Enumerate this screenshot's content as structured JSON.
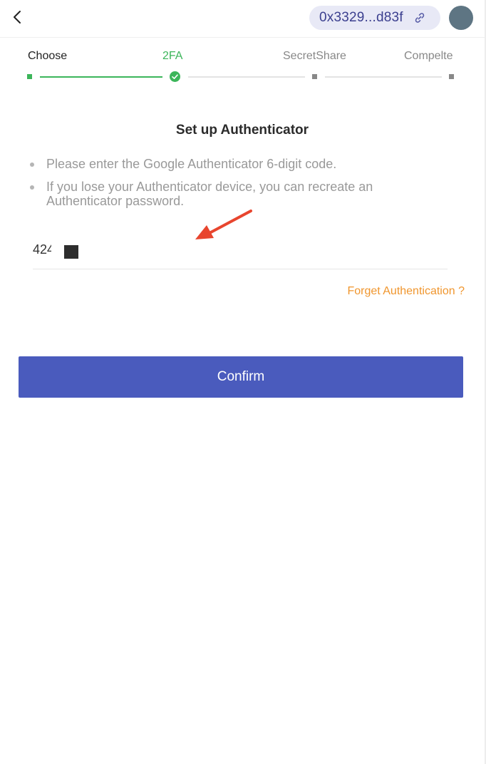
{
  "header": {
    "back_icon": "chevron-left-icon",
    "wallet_address": "0x3329...d83f",
    "link_icon": "link-icon",
    "avatar_color": "#5e7583"
  },
  "stepper": {
    "steps": [
      {
        "label": "Choose",
        "state": "done"
      },
      {
        "label": "2FA",
        "state": "current"
      },
      {
        "label": "SecretShare",
        "state": "pending"
      },
      {
        "label": "Compelte",
        "state": "pending"
      }
    ],
    "colors": {
      "active": "#3cb55a",
      "inactive": "#888888",
      "track_inactive": "#e3e3e3"
    }
  },
  "main": {
    "title": "Set up Authenticator",
    "instructions": [
      "Please enter the Google Authenticator 6-digit code.",
      "If you lose your Authenticator device, you can recreate an Authenticator password."
    ],
    "code_input": {
      "value": "424"
    },
    "forget_link": "Forget Authentication ?",
    "confirm_label": "Confirm"
  },
  "colors": {
    "accent": "#4a5bbd",
    "link": "#f0962e",
    "annotation_arrow": "#e8452e"
  }
}
